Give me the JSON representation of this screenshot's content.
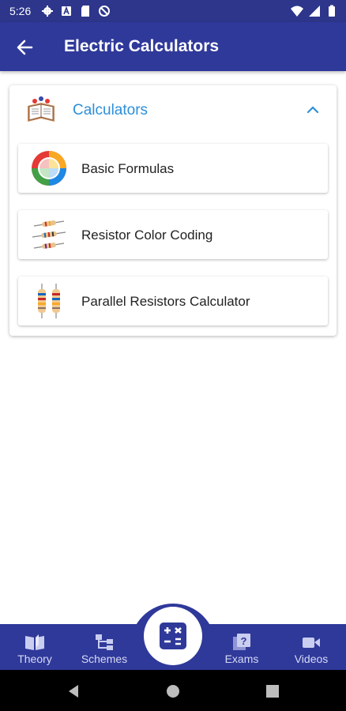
{
  "status_bar": {
    "time": "5:26",
    "left_icons": [
      "gear-icon",
      "a-badge-icon",
      "sd-card-icon",
      "circle-slash-icon"
    ],
    "right_icons": [
      "wifi-icon",
      "signal-icon",
      "battery-icon"
    ]
  },
  "app_bar": {
    "title": "Electric Calculators",
    "back_icon": "arrow-left-icon"
  },
  "section": {
    "label": "Calculators",
    "icon": "books-icon",
    "expanded_icon": "chevron-up-icon",
    "items": [
      {
        "label": "Basic Formulas",
        "icon": "formula-wheel-icon"
      },
      {
        "label": "Resistor Color Coding",
        "icon": "resistors-icon"
      },
      {
        "label": "Parallel Resistors Calculator",
        "icon": "parallel-resistors-icon"
      }
    ]
  },
  "bottom_nav": {
    "items": [
      {
        "label": "Theory",
        "icon": "book-icon"
      },
      {
        "label": "Schemes",
        "icon": "scheme-icon"
      },
      {
        "label": "Exams",
        "icon": "quiz-icon"
      },
      {
        "label": "Videos",
        "icon": "video-icon"
      }
    ],
    "center_icon": "calculator-icon"
  },
  "colors": {
    "primary": "#2f399a",
    "accent": "#2d8fd8"
  }
}
